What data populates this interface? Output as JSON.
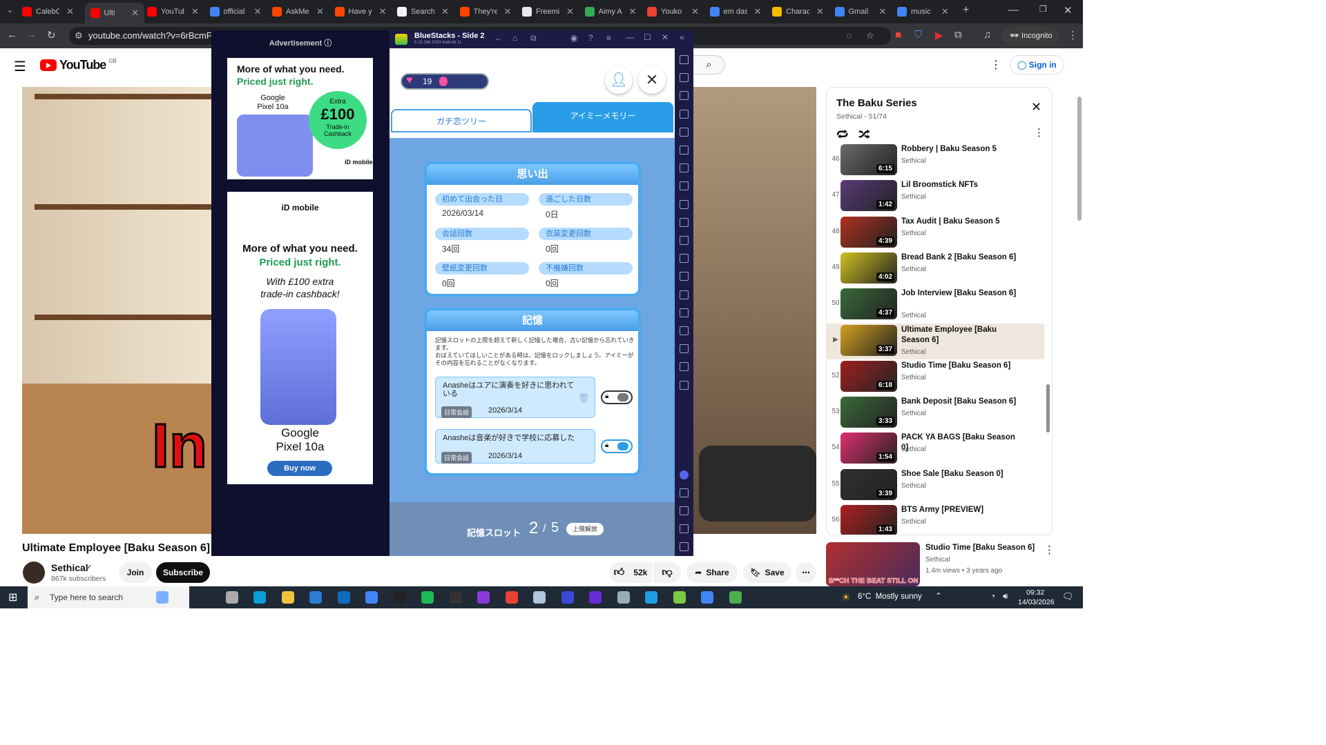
{
  "browser": {
    "tabs": [
      {
        "label": "CalebC",
        "color": "#ff0000"
      },
      {
        "label": "Ulti",
        "color": "#ff0000"
      },
      {
        "label": "YouTub",
        "color": "#ff0000"
      },
      {
        "label": "official",
        "color": "#4285f4"
      },
      {
        "label": "AskMe",
        "color": "#ff4500"
      },
      {
        "label": "Have y",
        "color": "#ff4500"
      },
      {
        "label": "Search",
        "color": "#f1f3f4"
      },
      {
        "label": "They're",
        "color": "#ff4500"
      },
      {
        "label": "Freemi",
        "color": "#e8eaed"
      },
      {
        "label": "Aimy A",
        "color": "#34a853"
      },
      {
        "label": "Youko",
        "color": "#ea4335"
      },
      {
        "label": "em das",
        "color": "#4285f4"
      },
      {
        "label": "Charac",
        "color": "#fbbc04"
      },
      {
        "label": "Gmail",
        "color": "#4285f4"
      },
      {
        "label": "music",
        "color": "#4285f4"
      }
    ],
    "url": "youtube.com/watch?v=6rBcmFFqhy",
    "incognito_label": "Incognito"
  },
  "youtube": {
    "logo_text": "YouTube",
    "region": "GB",
    "sign_in": "Sign in",
    "video_title": "Ultimate Employee [Baku Season 6]",
    "channel": "Sethical",
    "subscribers": "867k subscribers",
    "join": "Join",
    "subscribe": "Subscribe",
    "likes": "52k",
    "share": "Share",
    "save": "Save",
    "overlay_text": "In",
    "playlist": {
      "title": "The Baku Series",
      "subtitle": "Sethical - 51/74",
      "items": [
        {
          "num": "46",
          "title": "Robbery | Baku Season 5",
          "channel": "Sethical",
          "duration": "6:15",
          "color": "#6a6a6a"
        },
        {
          "num": "47",
          "title": "Lil Broomstick NFTs",
          "channel": "Sethical",
          "duration": "1:42",
          "color": "#5a3a7a"
        },
        {
          "num": "48",
          "title": "Tax Audit | Baku Season 5",
          "channel": "Sethical",
          "duration": "4:39",
          "color": "#b03020"
        },
        {
          "num": "49",
          "title": "Bread Bank 2 [Baku Season 6]",
          "channel": "Sethical",
          "duration": "4:02",
          "color": "#d0c020"
        },
        {
          "num": "50",
          "title": "Job Interview [Baku Season 6]",
          "channel": "Sethical",
          "duration": "4:37",
          "color": "#3a6a3a"
        },
        {
          "num": "▶",
          "title": "Ultimate Employee [Baku Season 6]",
          "channel": "Sethical",
          "duration": "3:37",
          "color": "#d4a020"
        },
        {
          "num": "52",
          "title": "Studio Time [Baku Season 6]",
          "channel": "Sethical",
          "duration": "6:18",
          "color": "#a02020"
        },
        {
          "num": "53",
          "title": "Bank Deposit [Baku Season 6]",
          "channel": "Sethical",
          "duration": "3:33",
          "color": "#3a6a3a"
        },
        {
          "num": "54",
          "title": "PACK YA BAGS [Baku Season 0]",
          "channel": "Sethical",
          "duration": "1:54",
          "color": "#e03070"
        },
        {
          "num": "55",
          "title": "Shoe Sale [Baku Season 0]",
          "channel": "Sethical",
          "duration": "3:39",
          "color": "#303030"
        },
        {
          "num": "56",
          "title": "BTS Army [PREVIEW]",
          "channel": "Sethical",
          "duration": "1:43",
          "color": "#b02020"
        }
      ]
    },
    "next_video": {
      "title": "Studio Time [Baku Season 6]",
      "channel": "Sethical",
      "meta": "1.4m views • 3 years ago",
      "thumb_text": "B**CH THE BEAT STILL ON"
    }
  },
  "ad": {
    "label": "Advertisement ⓘ",
    "card1": {
      "line1": "More of what you need.",
      "line2": "Priced just right.",
      "product": "Google Pixel 10a",
      "badge_top": "Extra",
      "badge_amount": "£100",
      "badge_bottom": "Trade-in Cashback",
      "brand": "iD mobile"
    },
    "card2": {
      "brand": "iD mobile",
      "line1": "More of what you need.",
      "line2": "Priced just right.",
      "line3": "With £100 extra",
      "line4": "trade-in cashback!",
      "product1": "Google",
      "product2": "Pixel 10a",
      "cta": "Buy now"
    }
  },
  "bluestacks": {
    "title": "BlueStacks - Side 2",
    "version": "5.22.166.1003 Android 11",
    "hearts": "19",
    "tabs": [
      "ガチ恋ツリー",
      "アイミーメモリー"
    ],
    "memories_header": "思い出",
    "stats": [
      {
        "label": "初めて出会った日",
        "value": "2026/03/14"
      },
      {
        "label": "過ごした日数",
        "value": "0日"
      },
      {
        "label": "会話回数",
        "value": "34回"
      },
      {
        "label": "衣装変更回数",
        "value": "0回"
      },
      {
        "label": "壁紙変更回数",
        "value": "0回"
      },
      {
        "label": "不機嫌回数",
        "value": "0回"
      }
    ],
    "memory_header": "記憶",
    "memory_desc1": "記憶スロットの上限を超えて新しく記憶した場合、古い記憶から忘れていきます。",
    "memory_desc2": "おぼえていてほしいことがある時は、記憶をロックしましょう。アイミーがその内容を忘れることがなくなります。",
    "memories": [
      {
        "text": "Anasheはユアに演奏を好きに思われている",
        "tag": "日常会話",
        "date": "2026/3/14",
        "locked": false
      },
      {
        "text": "Anasheは音楽が好きで学校に応募した",
        "tag": "日常会話",
        "date": "2026/3/14",
        "locked": true
      }
    ],
    "slot_label": "記憶スロット",
    "slot_used": "2",
    "slot_sep": "/",
    "slot_total": "5",
    "unlock": "上限解放"
  },
  "taskbar": {
    "search_placeholder": "Type here to search",
    "weather": "6°C  Mostly sunny",
    "time": "09:32",
    "date": "14/03/2026"
  }
}
